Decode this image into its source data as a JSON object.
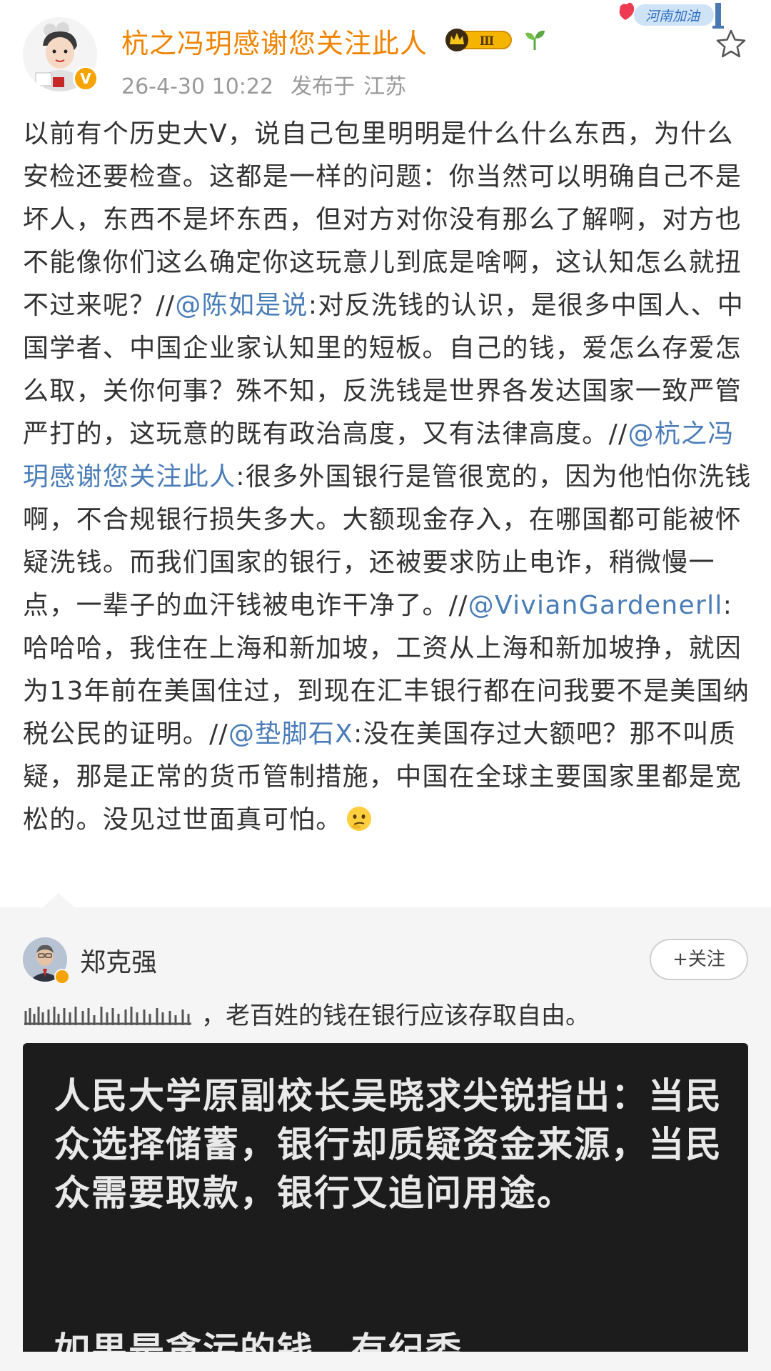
{
  "header": {
    "username": "杭之冯玥感谢您关注此人",
    "vip_level": "Ⅲ",
    "timestamp": "26-4-30 10:22",
    "published_at_label": "发布于",
    "location": "江苏",
    "event_badge_text": "河南加油",
    "verify_mark": "V"
  },
  "post": {
    "segments": [
      {
        "type": "text",
        "text": "以前有个历史大V，说自己包里明明是什么什么东西，为什么安检还要检查。这都是一样的问题：你当然可以明确自己不是坏人，东西不是坏东西，但对方对你没有那么了解啊，对方也不能像你们这么确定你这玩意儿到底是啥啊，这认知怎么就扭不过来呢？//"
      },
      {
        "type": "mention",
        "text": "@陈如是说"
      },
      {
        "type": "text",
        "text": ":对反洗钱的认识，是很多中国人、中国学者、中国企业家认知里的短板。自己的钱，爱怎么存爱怎么取，关你何事？殊不知，反洗钱是世界各发达国家一致严管严打的，这玩意的既有政治高度，又有法律高度。//"
      },
      {
        "type": "mention",
        "text": "@杭之冯玥感谢您关注此人"
      },
      {
        "type": "text",
        "text": ":很多外国银行是管很宽的，因为他怕你洗钱啊，不合规银行损失多大。大额现金存入，在哪国都可能被怀疑洗钱。而我们国家的银行，还被要求防止电诈，稍微慢一点，一辈子的血汗钱被电诈干净了。//"
      },
      {
        "type": "mention",
        "text": "@VivianGardenerll"
      },
      {
        "type": "text",
        "text": ":哈哈哈，我住在上海和新加坡，工资从上海和新加坡挣，就因为13年前在美国住过，到现在汇丰银行都在问我要不是美国纳税公民的证明。//"
      },
      {
        "type": "mention",
        "text": "@垫脚石X"
      },
      {
        "type": "text",
        "text": ":没在美国存过大额吧？那不叫质疑，那是正常的货币管制措施，中国在全球主要国家里都是宽松的。没见过世面真可怕。"
      }
    ],
    "end_emoji": "thinking-face-icon"
  },
  "repost": {
    "author": "郑克强",
    "follow_label": "+关注",
    "text": "，老百姓的钱在银行应该存取自由。",
    "image_text": "人民大学原副校长吴晓求尖锐指出：当民众选择储蓄，银行却质疑资金来源，当民众需要取款，银行又追问用途。",
    "image_text_2": "如果是贪污的钱，有纪委"
  },
  "colors": {
    "username": "#f08400",
    "mention": "#4a7db8",
    "meta": "#9a9a9a",
    "repost_bg": "#f5f5f5",
    "image_bg": "#1c1c1c"
  }
}
